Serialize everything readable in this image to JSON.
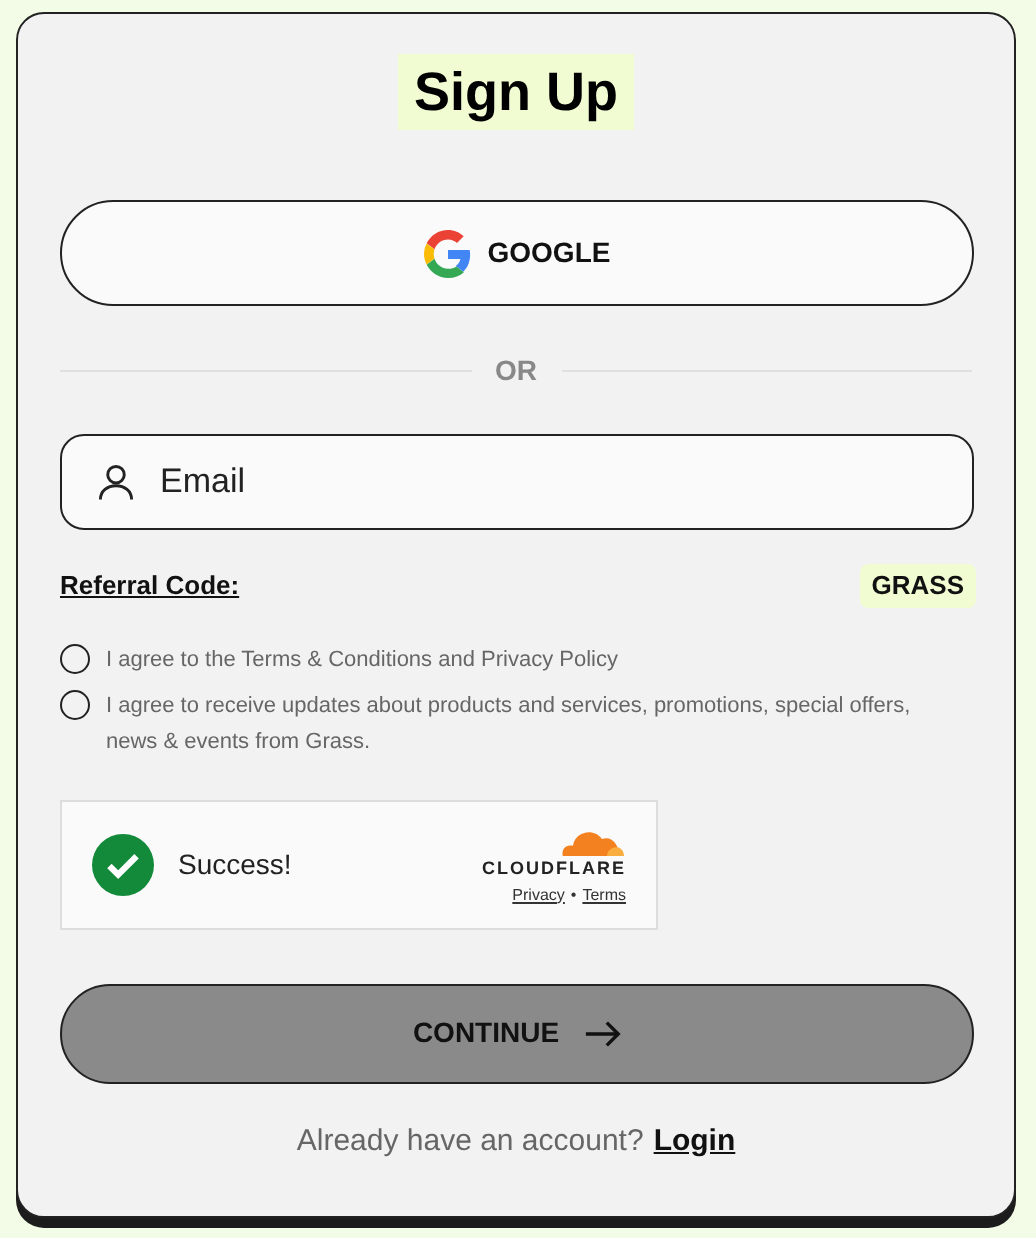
{
  "title": "Sign Up",
  "google_button": {
    "label": "GOOGLE"
  },
  "divider": {
    "label": "OR"
  },
  "email_field": {
    "placeholder": "Email"
  },
  "referral": {
    "label": "Referral Code:",
    "code": "GRASS"
  },
  "checkboxes": [
    {
      "label": "I agree to the Terms & Conditions and Privacy Policy",
      "checked": false
    },
    {
      "label": "I agree to receive updates about products and services, promotions, special offers, news & events from Grass.",
      "checked": false
    }
  ],
  "captcha": {
    "status": "Success!",
    "brand": "CLOUDFLARE",
    "links": [
      "Privacy",
      "Terms"
    ],
    "separator": "•"
  },
  "continue_button": {
    "label": "CONTINUE",
    "disabled": true
  },
  "footer": {
    "text": "Already have an account?",
    "link": "Login"
  }
}
